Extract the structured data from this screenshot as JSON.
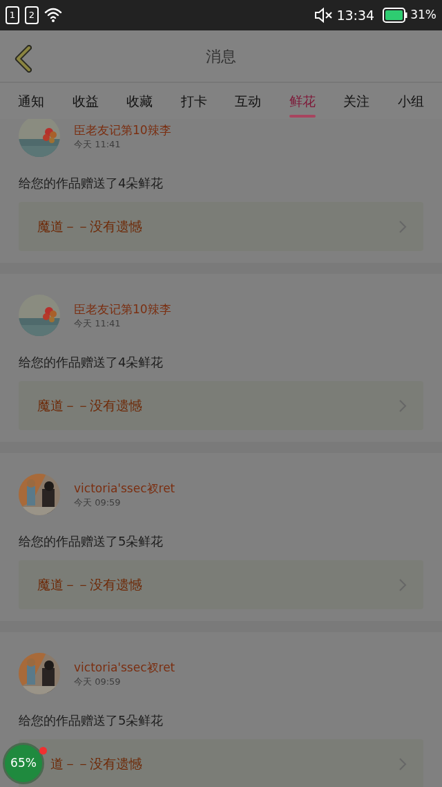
{
  "status_bar": {
    "sim_1": "1",
    "sim_2": "2",
    "time": "13:34",
    "battery": "31%"
  },
  "header": {
    "title": "消息"
  },
  "tabs": [
    {
      "label": "通知",
      "selected": false
    },
    {
      "label": "收益",
      "selected": false
    },
    {
      "label": "收藏",
      "selected": false
    },
    {
      "label": "打卡",
      "selected": false
    },
    {
      "label": "互动",
      "selected": false
    },
    {
      "label": "鲜花",
      "selected": true
    },
    {
      "label": "关注",
      "selected": false
    },
    {
      "label": "小组",
      "selected": false
    }
  ],
  "messages": [
    {
      "name": "臣老友记第10辣李",
      "time": "今天 11:41",
      "text": "给您的作品赠送了4朵鲜花",
      "work": "魔道－－没有遗憾"
    },
    {
      "name": "臣老友记第10辣李",
      "time": "今天 11:41",
      "text": "给您的作品赠送了4朵鲜花",
      "work": "魔道－－没有遗憾"
    },
    {
      "name": "victoria'ssec衩ret",
      "time": "今天 09:59",
      "text": "给您的作品赠送了5朵鲜花",
      "work": "魔道－－没有遗憾"
    },
    {
      "name": "victoria'ssec衩ret",
      "time": "今天 09:59",
      "text": "给您的作品赠送了5朵鲜花",
      "work": "道－－没有遗憾"
    }
  ],
  "floating_badge": {
    "text": "65%"
  }
}
